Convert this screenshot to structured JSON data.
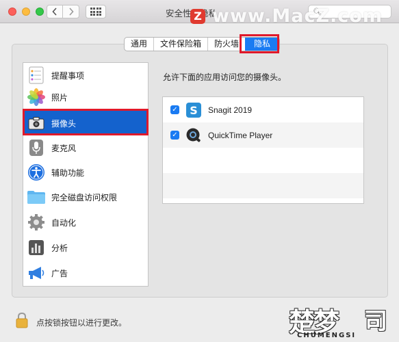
{
  "window": {
    "title": "安全性与隐私",
    "search_placeholder": "",
    "lock_text": "点按锁按钮以进行更改。"
  },
  "tabs": [
    {
      "label": "通用",
      "active": false
    },
    {
      "label": "文件保险箱",
      "active": false
    },
    {
      "label": "防火墙",
      "active": false
    },
    {
      "label": "隐私",
      "active": true
    }
  ],
  "sidebar": {
    "items": [
      {
        "label": "提醒事项",
        "icon": "reminders-icon",
        "selected": false
      },
      {
        "label": "照片",
        "icon": "photos-icon",
        "selected": false
      },
      {
        "label": "摄像头",
        "icon": "camera-icon",
        "selected": true
      },
      {
        "label": "麦克风",
        "icon": "microphone-icon",
        "selected": false
      },
      {
        "label": "辅助功能",
        "icon": "accessibility-icon",
        "selected": false
      },
      {
        "label": "完全磁盘访问权限",
        "icon": "folder-icon",
        "selected": false
      },
      {
        "label": "自动化",
        "icon": "gear-icon",
        "selected": false
      },
      {
        "label": "分析",
        "icon": "analytics-icon",
        "selected": false
      },
      {
        "label": "广告",
        "icon": "megaphone-icon",
        "selected": false
      }
    ]
  },
  "main": {
    "prompt": "允许下面的应用访问您的摄像头。",
    "apps": [
      {
        "name": "Snagit 2019",
        "checked": true,
        "icon": "snagit-icon"
      },
      {
        "name": "QuickTime Player",
        "checked": true,
        "icon": "quicktime-icon"
      }
    ]
  },
  "watermarks": {
    "top": "www.MacZ.com",
    "brand_cn_1": "楚梦",
    "brand_cn_2": "司",
    "brand_en": "CHUMENGSI"
  },
  "colors": {
    "accent": "#1a7bf2",
    "selection": "#1462cd",
    "highlight_box": "#e0192b"
  }
}
